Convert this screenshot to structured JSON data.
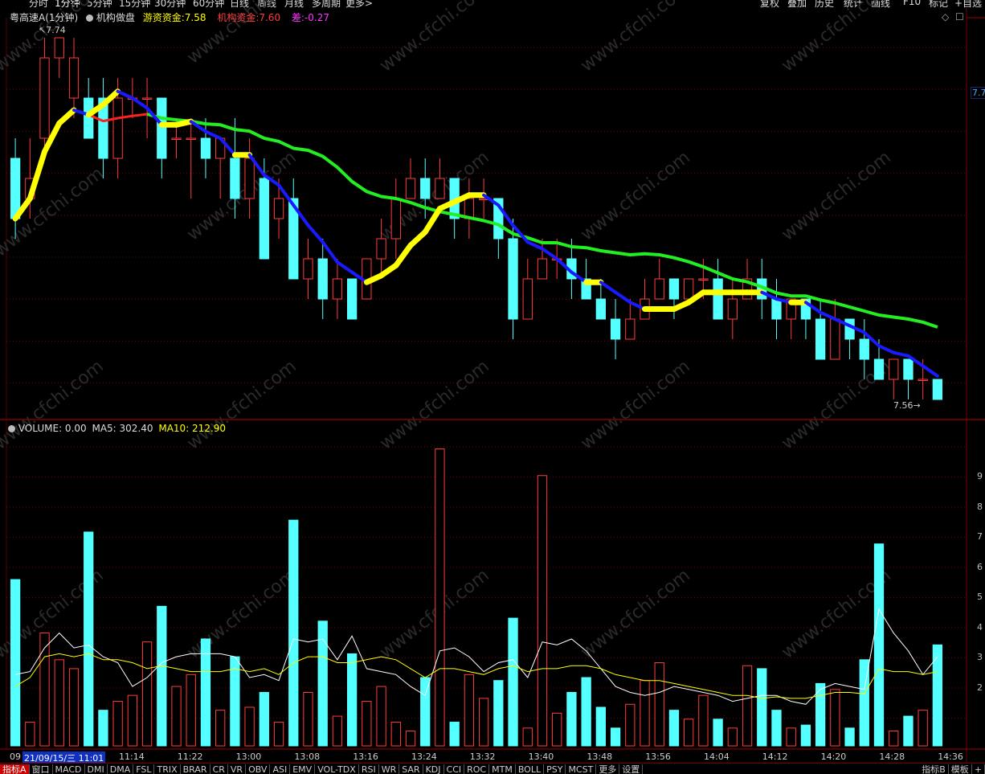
{
  "periods": [
    "分时",
    "1分钟",
    "5分钟",
    "15分钟",
    "30分钟",
    "60分钟",
    "日线",
    "周线",
    "月线",
    "多周期",
    "更多>"
  ],
  "active_period": 1,
  "right_tools": [
    "复权",
    "叠加",
    "历史",
    "统计",
    "画线",
    "F10",
    "标记",
    "+自选"
  ],
  "stock": {
    "name": "粤高速A",
    "period": "(1分钟)"
  },
  "indicator": {
    "name": "机构做盘",
    "youzi_label": "游资资金:",
    "youzi_value": "7.58",
    "jigou_label": "机构资金:",
    "jigou_value": "7.60",
    "cha_label": "差:",
    "cha_value": "-0.27"
  },
  "price_high": "7.74",
  "price_low": "7.56",
  "right_price_tag": "7.7",
  "volume": {
    "label": "VOLUME: 0.00",
    "ma5": "MA5: 302.40",
    "ma10": "MA10: 212.90"
  },
  "time_cursor": "21/09/15/三 11:01",
  "time_axis_start": "09",
  "time_labels": [
    "11:14",
    "11:22",
    "13:00",
    "13:08",
    "13:16",
    "13:24",
    "13:32",
    "13:40",
    "13:48",
    "13:56",
    "14:04",
    "14:12",
    "14:20",
    "14:28",
    "14:36"
  ],
  "vol_scale": [
    "9",
    "8",
    "7",
    "6",
    "5",
    "4",
    "3",
    "2"
  ],
  "watermark": "www.cfchi.com",
  "bottom_tabs": [
    "指标A",
    "窗口",
    "MACD",
    "DMI",
    "DMA",
    "FSL",
    "TRIX",
    "BRAR",
    "CR",
    "VR",
    "OBV",
    "ASI",
    "EMV",
    "VOL-TDX",
    "RSI",
    "WR",
    "SAR",
    "KDJ",
    "CCI",
    "ROC",
    "MTM",
    "BOLL",
    "PSY",
    "MCST",
    "更多",
    "设置"
  ],
  "bottom_right": [
    "指标B",
    "模板",
    "+"
  ],
  "colors": {
    "up": "#ff3b3b",
    "down": "#54ffff",
    "ma_blue": "#1a1aff",
    "ma_green": "#22ee22",
    "ma_red": "#ff2020",
    "ma_yellow": "#ffff00",
    "grid": "#7a0000"
  },
  "chart_data": {
    "type": "candlestick",
    "price_range": [
      7.55,
      7.75
    ],
    "candles": [
      [
        7.68,
        7.65,
        7.69,
        7.64
      ],
      [
        7.66,
        7.67,
        7.69,
        7.65
      ],
      [
        7.69,
        7.73,
        7.74,
        7.68
      ],
      [
        7.73,
        7.74,
        7.74,
        7.72
      ],
      [
        7.71,
        7.73,
        7.74,
        7.7
      ],
      [
        7.71,
        7.69,
        7.72,
        7.69
      ],
      [
        7.71,
        7.68,
        7.72,
        7.67
      ],
      [
        7.68,
        7.71,
        7.72,
        7.67
      ],
      [
        7.71,
        7.71,
        7.72,
        7.7
      ],
      [
        7.71,
        7.71,
        7.72,
        7.69
      ],
      [
        7.71,
        7.68,
        7.71,
        7.67
      ],
      [
        7.69,
        7.69,
        7.7,
        7.68
      ],
      [
        7.69,
        7.69,
        7.7,
        7.66
      ],
      [
        7.69,
        7.68,
        7.7,
        7.67
      ],
      [
        7.68,
        7.69,
        7.69,
        7.66
      ],
      [
        7.68,
        7.66,
        7.7,
        7.65
      ],
      [
        7.66,
        7.68,
        7.69,
        7.65
      ],
      [
        7.67,
        7.63,
        7.68,
        7.63
      ],
      [
        7.65,
        7.66,
        7.67,
        7.64
      ],
      [
        7.66,
        7.62,
        7.67,
        7.62
      ],
      [
        7.62,
        7.63,
        7.64,
        7.61
      ],
      [
        7.63,
        7.61,
        7.64,
        7.6
      ],
      [
        7.61,
        7.62,
        7.63,
        7.6
      ],
      [
        7.62,
        7.6,
        7.62,
        7.6
      ],
      [
        7.61,
        7.63,
        7.63,
        7.61
      ],
      [
        7.63,
        7.64,
        7.65,
        7.62
      ],
      [
        7.64,
        7.66,
        7.67,
        7.63
      ],
      [
        7.66,
        7.67,
        7.68,
        7.66
      ],
      [
        7.67,
        7.66,
        7.68,
        7.65
      ],
      [
        7.66,
        7.67,
        7.68,
        7.66
      ],
      [
        7.67,
        7.65,
        7.67,
        7.64
      ],
      [
        7.65,
        7.66,
        7.67,
        7.64
      ],
      [
        7.66,
        7.66,
        7.67,
        7.65
      ],
      [
        7.66,
        7.64,
        7.66,
        7.63
      ],
      [
        7.64,
        7.6,
        7.65,
        7.59
      ],
      [
        7.6,
        7.62,
        7.63,
        7.6
      ],
      [
        7.62,
        7.63,
        7.64,
        7.62
      ],
      [
        7.63,
        7.63,
        7.64,
        7.62
      ],
      [
        7.63,
        7.62,
        7.64,
        7.61
      ],
      [
        7.62,
        7.61,
        7.63,
        7.61
      ],
      [
        7.61,
        7.6,
        7.62,
        7.6
      ],
      [
        7.6,
        7.59,
        7.61,
        7.58
      ],
      [
        7.59,
        7.6,
        7.61,
        7.59
      ],
      [
        7.6,
        7.61,
        7.62,
        7.6
      ],
      [
        7.61,
        7.62,
        7.63,
        7.61
      ],
      [
        7.62,
        7.61,
        7.62,
        7.6
      ],
      [
        7.61,
        7.62,
        7.62,
        7.61
      ],
      [
        7.62,
        7.62,
        7.63,
        7.61
      ],
      [
        7.62,
        7.6,
        7.63,
        7.6
      ],
      [
        7.6,
        7.61,
        7.62,
        7.59
      ],
      [
        7.61,
        7.62,
        7.63,
        7.61
      ],
      [
        7.62,
        7.61,
        7.63,
        7.6
      ],
      [
        7.61,
        7.6,
        7.62,
        7.59
      ],
      [
        7.6,
        7.61,
        7.61,
        7.59
      ],
      [
        7.61,
        7.6,
        7.61,
        7.59
      ],
      [
        7.6,
        7.58,
        7.61,
        7.58
      ],
      [
        7.58,
        7.6,
        7.61,
        7.58
      ],
      [
        7.6,
        7.59,
        7.6,
        7.58
      ],
      [
        7.59,
        7.58,
        7.6,
        7.57
      ],
      [
        7.58,
        7.57,
        7.59,
        7.57
      ],
      [
        7.57,
        7.58,
        7.58,
        7.56
      ],
      [
        7.58,
        7.57,
        7.58,
        7.56
      ],
      [
        7.57,
        7.57,
        7.58,
        7.56
      ],
      [
        7.57,
        7.56,
        7.57,
        7.56
      ]
    ],
    "volume": [
      560,
      80,
      380,
      290,
      260,
      720,
      120,
      150,
      170,
      350,
      470,
      200,
      240,
      360,
      120,
      300,
      130,
      180,
      80,
      760,
      180,
      420,
      100,
      310,
      150,
      200,
      80,
      50,
      230,
      1000,
      80,
      240,
      160,
      220,
      430,
      60,
      910,
      110,
      180,
      230,
      130,
      60,
      140,
      220,
      280,
      120,
      90,
      170,
      90,
      60,
      270,
      260,
      120,
      60,
      70,
      210,
      190,
      60,
      290,
      680,
      50,
      100,
      120,
      340
    ],
    "ma5": [
      240,
      250,
      330,
      380,
      330,
      340,
      300,
      280,
      200,
      230,
      280,
      300,
      310,
      310,
      310,
      300,
      230,
      240,
      220,
      360,
      350,
      360,
      290,
      370,
      260,
      250,
      240,
      200,
      170,
      320,
      330,
      300,
      250,
      280,
      290,
      230,
      350,
      340,
      360,
      320,
      260,
      200,
      180,
      170,
      180,
      200,
      190,
      180,
      170,
      150,
      160,
      170,
      170,
      150,
      140,
      190,
      210,
      200,
      190,
      460,
      380,
      320,
      240,
      300
    ],
    "ma10": [
      200,
      230,
      300,
      310,
      300,
      310,
      290,
      290,
      280,
      260,
      270,
      260,
      250,
      250,
      250,
      260,
      250,
      260,
      240,
      280,
      300,
      300,
      280,
      280,
      290,
      300,
      290,
      260,
      230,
      260,
      260,
      250,
      240,
      260,
      270,
      250,
      260,
      260,
      270,
      270,
      260,
      240,
      230,
      220,
      220,
      210,
      200,
      190,
      180,
      170,
      170,
      160,
      165,
      160,
      160,
      170,
      180,
      180,
      175,
      260,
      250,
      250,
      240,
      250
    ]
  }
}
